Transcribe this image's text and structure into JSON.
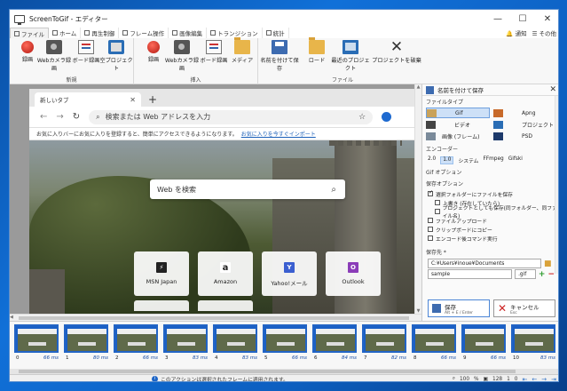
{
  "window": {
    "title": "ScreenToGif - エディター",
    "controls": [
      "—",
      "☐",
      "✕"
    ]
  },
  "tabs": [
    {
      "label": "ファイル",
      "active": true
    },
    {
      "label": "ホーム"
    },
    {
      "label": "再生制御"
    },
    {
      "label": "フレーム操作"
    },
    {
      "label": "画像編集"
    },
    {
      "label": "トランジション"
    },
    {
      "label": "統計"
    }
  ],
  "tabs_right": {
    "notify": "通知",
    "other": "その他"
  },
  "ribbon": {
    "groups": [
      {
        "label": "新規",
        "buttons": [
          "録画",
          "Webカメラ録画",
          "ボード録画",
          "空プロジェクト"
        ]
      },
      {
        "label": "挿入",
        "buttons": [
          "録画",
          "Webカメラ録画",
          "ボード録画",
          "メディア"
        ]
      },
      {
        "label": "ファイル",
        "buttons": [
          "名前を付けて保存",
          "ロード",
          "最近のプロジェクト",
          "プロジェクトを破棄"
        ]
      }
    ]
  },
  "browser": {
    "tab_title": "新しいタブ",
    "address_placeholder": "検索または Web アドレスを入力",
    "favorites_text": "お気に入りバーにお気に入りを登録すると、簡単にアクセスできるようになります。",
    "favorites_link": "お気に入りを今すぐインポート",
    "search_placeholder": "Web を検索",
    "tiles": [
      {
        "label": "MSN Japan",
        "logo": "⚡",
        "color": "#222222"
      },
      {
        "label": "Amazon",
        "logo": "a",
        "color": "#222222"
      },
      {
        "label": "Yahoo!メール",
        "logo": "Y",
        "color": "#3b5fd0"
      },
      {
        "label": "Outlook",
        "logo": "O",
        "color": "#8b3db8"
      }
    ]
  },
  "panel": {
    "title": "名前を付けて保存",
    "filetype_label": "ファイルタイプ",
    "filetypes": [
      "Gif",
      "Apng",
      "ビデオ",
      "プロジェクト",
      "画像 (フレーム)",
      "PSD"
    ],
    "encoder_label": "エンコーダー",
    "encoders": [
      "2.0",
      "1.0",
      "システム",
      "FFmpeg",
      "Gifski"
    ],
    "gif_options_label": "Gif オプション",
    "save_options_label": "保存オプション",
    "options": [
      {
        "label": "選択フォルダーにファイルを保存",
        "checked": true,
        "sub": false
      },
      {
        "label": "上書き (存在していたら)",
        "checked": false,
        "sub": true
      },
      {
        "label": "プロジェクトとしても保存(同フォルダー、同ファイル名)",
        "checked": false,
        "sub": true
      },
      {
        "label": "ファイルアップロード",
        "checked": false,
        "sub": false
      },
      {
        "label": "クリップボードにコピー",
        "checked": false,
        "sub": false
      },
      {
        "label": "エンコード後コマンド実行",
        "checked": false,
        "sub": false
      }
    ],
    "dest_label": "保存先 *",
    "dest_path": "C:¥Users¥inoue¥Documents",
    "filename": "sample",
    "extension": ".gif",
    "save_button": "保存",
    "save_shortcut": "Alt + E / Enter",
    "cancel_button": "キャンセル",
    "cancel_shortcut": "Esc"
  },
  "frames": [
    {
      "n": "0",
      "d": "66 ms"
    },
    {
      "n": "1",
      "d": "80 ms"
    },
    {
      "n": "2",
      "d": "66 ms"
    },
    {
      "n": "3",
      "d": "83 ms"
    },
    {
      "n": "4",
      "d": "83 ms"
    },
    {
      "n": "5",
      "d": "66 ms"
    },
    {
      "n": "6",
      "d": "84 ms"
    },
    {
      "n": "7",
      "d": "82 ms"
    },
    {
      "n": "8",
      "d": "66 ms"
    },
    {
      "n": "9",
      "d": "66 ms"
    },
    {
      "n": "10",
      "d": "83 ms"
    }
  ],
  "status": {
    "message": "このアクションは選択されたフレームに適用されます。",
    "zoom": "100",
    "zoom_unit": "%",
    "frame_count": "128",
    "selected": "1",
    "current": "0"
  }
}
